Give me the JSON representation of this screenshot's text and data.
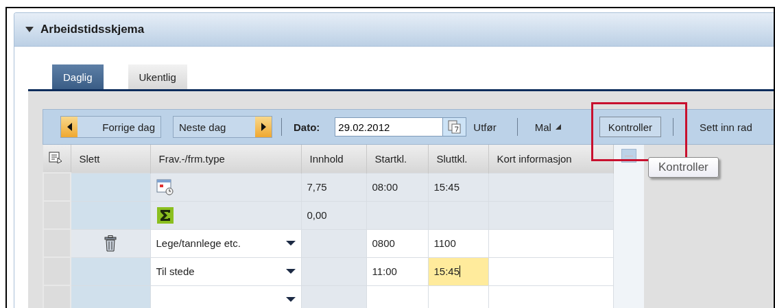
{
  "panel": {
    "title": "Arbeidstidsskjema",
    "expanded": true
  },
  "tabs": [
    {
      "label": "Daglig",
      "selected": true
    },
    {
      "label": "Ukentlig",
      "selected": false
    }
  ],
  "toolbar": {
    "previous": "Forrige dag",
    "next": "Neste dag",
    "date_label": "Dato:",
    "date_value": "29.02.2012",
    "execute": "Utfør",
    "template": "Mal",
    "check": "Kontroller",
    "insert_row": "Sett inn rad"
  },
  "table": {
    "columns": [
      "Slett",
      "Frav.-/frm.type",
      "Innhold",
      "Startkl.",
      "Sluttkl.",
      "Kort informasjon"
    ],
    "rows": [
      {
        "kind": "planned",
        "innhold": "7,75",
        "start": "08:00",
        "end": "15:45",
        "deletable": false
      },
      {
        "kind": "sum",
        "innhold": "0,00",
        "deletable": false
      },
      {
        "kind": "entry",
        "type": "Lege/tannlege etc.",
        "start": "0800",
        "end": "1100",
        "deletable": true,
        "end_focused": false
      },
      {
        "kind": "entry",
        "type": "Til stede",
        "start": "11:00",
        "end": "15:45",
        "deletable": false,
        "end_focused": true
      },
      {
        "kind": "entry",
        "deletable": false,
        "end_focused": false
      }
    ]
  },
  "tooltip": "Kontroller"
}
